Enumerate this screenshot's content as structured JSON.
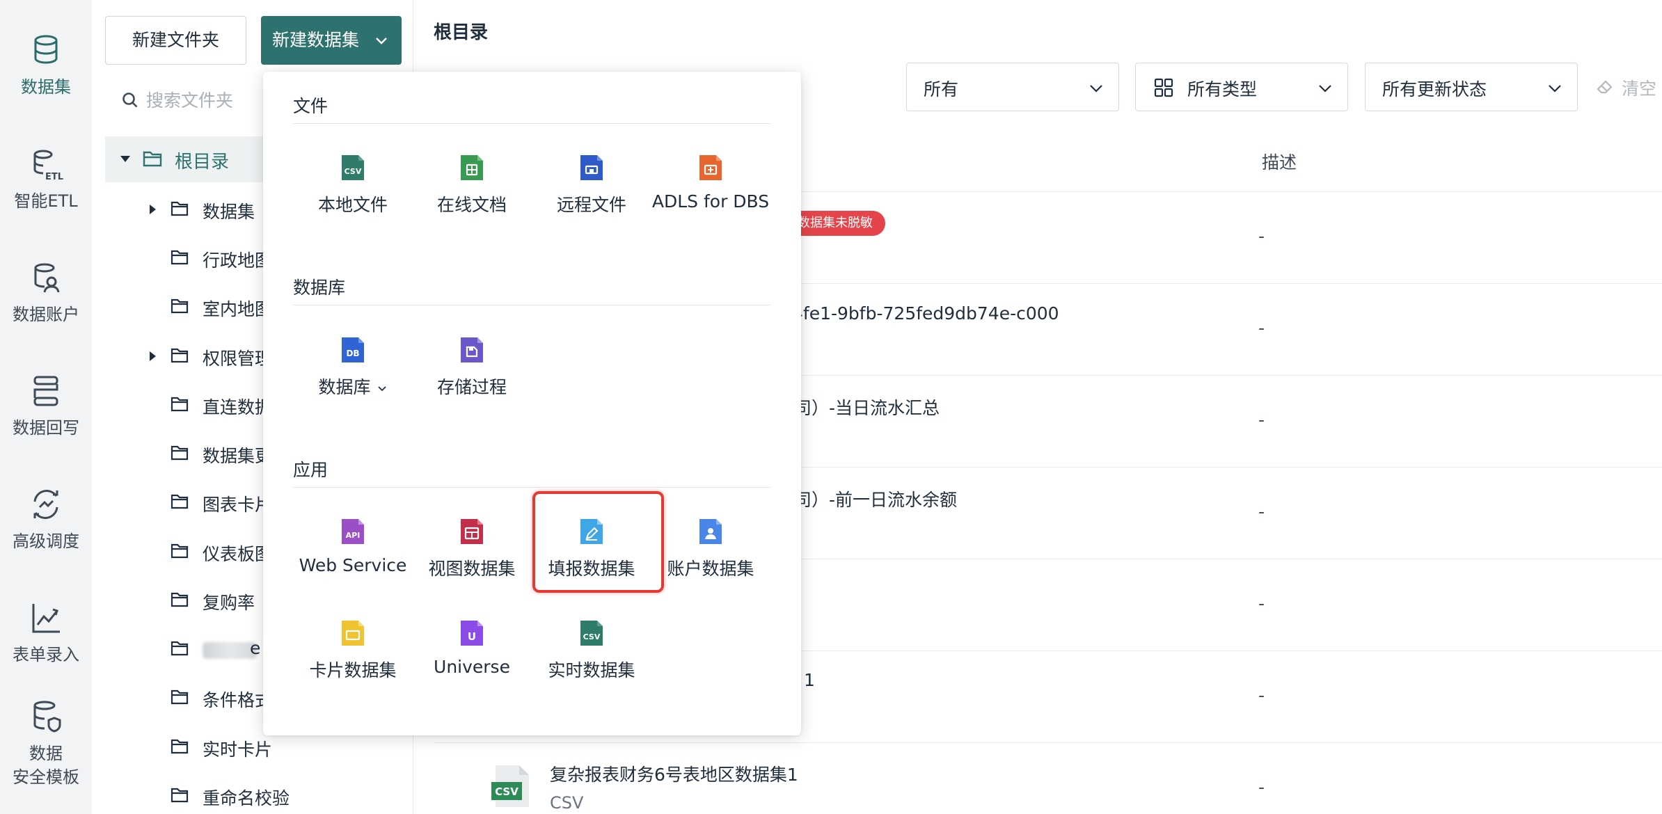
{
  "rail": {
    "items": [
      {
        "label": "数据集",
        "icon": "database-icon"
      },
      {
        "label": "智能ETL",
        "icon": "etl-icon"
      },
      {
        "label": "数据账户",
        "icon": "data-account-icon"
      },
      {
        "label": "数据回写",
        "icon": "writeback-icon"
      },
      {
        "label": "高级调度",
        "icon": "schedule-icon"
      },
      {
        "label": "表单录入",
        "icon": "form-entry-icon"
      },
      {
        "label": "数据",
        "label2": "安全模板",
        "icon": "security-template-icon"
      }
    ]
  },
  "toolbar": {
    "new_folder": "新建文件夹",
    "new_dataset": "新建数据集"
  },
  "folder_search": {
    "placeholder": "搜索文件夹"
  },
  "tree": {
    "root": "根目录",
    "items": [
      "数据集",
      "行政地图",
      "室内地图",
      "权限管理",
      "直连数据",
      "数据集更",
      "图表卡片",
      "仪表板图",
      "复购率",
      "e",
      "条件格式",
      "实时卡片",
      "重命名校验"
    ]
  },
  "main": {
    "title": "根目录",
    "filters": {
      "owner": "所有",
      "type": "所有类型",
      "update_status": "所有更新状态",
      "clear": "清空"
    },
    "columns": {
      "description": "描述"
    },
    "rows": [
      {
        "name_fragment": "",
        "badge": "数据集未脱敏",
        "desc": "-"
      },
      {
        "name_fragment": "4fe1-9bfb-725fed9db74e-c000",
        "desc": "-"
      },
      {
        "name_fragment": "司）-当日流水汇总",
        "desc": "-"
      },
      {
        "name_fragment": "司）-前一日流水余额",
        "desc": "-"
      },
      {
        "name_fragment": "",
        "desc": "-"
      },
      {
        "name_fragment": "1",
        "desc": "-"
      },
      {
        "name": "复杂报表财务6号表地区数据集1",
        "type": "CSV",
        "desc": "-"
      }
    ]
  },
  "dropdown": {
    "sections": [
      {
        "title": "文件",
        "items": [
          "本地文件",
          "在线文档",
          "远程文件",
          "ADLS for DBS"
        ]
      },
      {
        "title": "数据库",
        "items": [
          "数据库",
          "存储过程"
        ]
      },
      {
        "title": "应用",
        "items": [
          "Web Service",
          "视图数据集",
          "填报数据集",
          "账户数据集",
          "卡片数据集",
          "Universe",
          "实时数据集"
        ]
      }
    ],
    "icon_text": {
      "csv": "CSV",
      "db": "DB",
      "api": "API",
      "universe": "U"
    },
    "highlighted_item": "填报数据集"
  },
  "colors": {
    "primary": "#2e7270",
    "rail_bg": "#f1f3f4",
    "badge_red": "#e5454a",
    "highlight_red": "#e43a33"
  }
}
